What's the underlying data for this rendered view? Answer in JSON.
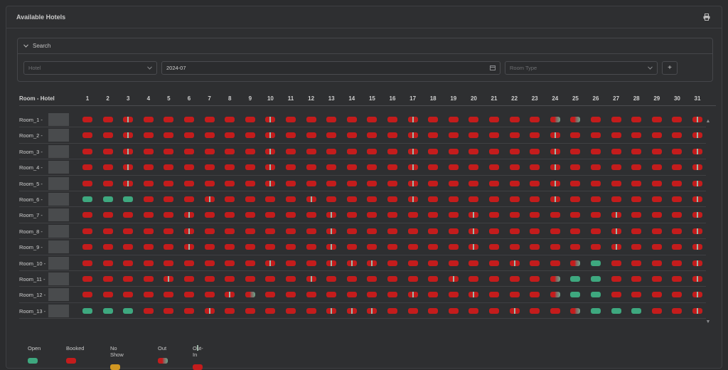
{
  "header": {
    "title": "Available Hotels",
    "print_icon": "printer-icon"
  },
  "search": {
    "label": "Search",
    "hotel_placeholder": "Hotel",
    "date_value": "2024-07",
    "room_type_placeholder": "Room Type",
    "add_label": "+"
  },
  "grid": {
    "column_title": "Room - Hotel",
    "days": [
      "1",
      "2",
      "3",
      "4",
      "5",
      "6",
      "7",
      "8",
      "9",
      "10",
      "11",
      "12",
      "13",
      "14",
      "15",
      "16",
      "17",
      "18",
      "19",
      "20",
      "21",
      "22",
      "23",
      "24",
      "25",
      "26",
      "27",
      "28",
      "29",
      "30",
      "31"
    ],
    "rooms": [
      {
        "label": "Room_1 -",
        "status": "BBXBBBBBBXBBBBBBXBBBBBBOOBBBBBX"
      },
      {
        "label": "Room_2 -",
        "status": "BBXBBBBBBXBBBBBBXBBBBBBXBBBBBBX"
      },
      {
        "label": "Room_3 -",
        "status": "BBXBBBBBBXBBBBBBXBBBBBBXBBBBBBX"
      },
      {
        "label": "Room_4 -",
        "status": "BBXBBBBBBXBBBBBBXBBBBBBXBBBBBBX"
      },
      {
        "label": "Room_5 -",
        "status": "BBXBBBBBBXBBBBBBXBBBBBBXBBBBBBX"
      },
      {
        "label": "Room_6 -",
        "status": "GGGBBBXBBBBXBBBBXBBBBBBXBBBBBBX"
      },
      {
        "label": "Room_7 -",
        "status": "BBBBBXBBBBBBXBBBBBBXBBBBBBXBBBX"
      },
      {
        "label": "Room_8 -",
        "status": "BBBBBXBBBBBBXBBBBBBXBBBBBBXBBBX"
      },
      {
        "label": "Room_9 -",
        "status": "BBBBBXBBBBBBXBBBBBBXBBBBBBXBBBX"
      },
      {
        "label": "Room_10 -",
        "status": "BBBBBBBBBXBBXXXBBBBBBXBBOGBBBBX"
      },
      {
        "label": "Room_11 -",
        "status": "BBBBXBBBBBBXBBBBBBXBBBBOGGBBBBX"
      },
      {
        "label": "Room_12 -",
        "status": "BBBBBBBXOBBBBBBBXBBXBBBOGGBBBBX"
      },
      {
        "label": "Room_13 -",
        "status": "GGGBBBXBBBBBXXXBBBBBBXBBOGGGBBX"
      }
    ]
  },
  "legend": [
    {
      "label": "Open",
      "kind": "open"
    },
    {
      "label": "Booked",
      "kind": "booked"
    },
    {
      "label": "No Show",
      "kind": "noshow"
    },
    {
      "label": "Out",
      "kind": "out"
    },
    {
      "label": "Out-In",
      "kind": "outin"
    }
  ],
  "colors": {
    "booked": "#c41c1c",
    "open": "#3ea87f",
    "noshow": "#d19722"
  }
}
